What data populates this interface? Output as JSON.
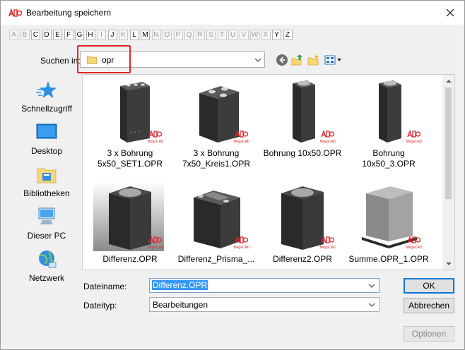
{
  "window": {
    "title": "Bearbeitung speichern"
  },
  "letters": [
    {
      "ch": "A",
      "on": false
    },
    {
      "ch": "B",
      "on": false
    },
    {
      "ch": "C",
      "on": true
    },
    {
      "ch": "D",
      "on": true
    },
    {
      "ch": "E",
      "on": true
    },
    {
      "ch": "F",
      "on": true
    },
    {
      "ch": "G",
      "on": true
    },
    {
      "ch": "H",
      "on": true
    },
    {
      "ch": "I",
      "on": false
    },
    {
      "ch": "J",
      "on": true
    },
    {
      "ch": "K",
      "on": false
    },
    {
      "ch": "L",
      "on": true
    },
    {
      "ch": "M",
      "on": true
    },
    {
      "ch": "N",
      "on": false
    },
    {
      "ch": "O",
      "on": false
    },
    {
      "ch": "P",
      "on": false
    },
    {
      "ch": "Q",
      "on": false
    },
    {
      "ch": "R",
      "on": false
    },
    {
      "ch": "S",
      "on": false
    },
    {
      "ch": "T",
      "on": false
    },
    {
      "ch": "U",
      "on": false
    },
    {
      "ch": "V",
      "on": false
    },
    {
      "ch": "W",
      "on": false
    },
    {
      "ch": "X",
      "on": false
    },
    {
      "ch": "Y",
      "on": true
    },
    {
      "ch": "Z",
      "on": true
    }
  ],
  "lookin": {
    "label": "Suchen in:",
    "value": "opr"
  },
  "places": [
    {
      "label": "Schnellzugriff",
      "icon": "star-icon"
    },
    {
      "label": "Desktop",
      "icon": "desktop-icon"
    },
    {
      "label": "Bibliotheken",
      "icon": "libraries-icon"
    },
    {
      "label": "Dieser PC",
      "icon": "computer-icon"
    },
    {
      "label": "Netzwerk",
      "icon": "network-icon"
    }
  ],
  "files": [
    {
      "line1": "3 x Bohrung",
      "line2": "5x50_SET1.OPR",
      "selected": false
    },
    {
      "line1": "3 x Bohrung",
      "line2": "7x50_Kreis1.OPR",
      "selected": false
    },
    {
      "line1": "Bohrung 10x50.OPR",
      "line2": "",
      "selected": false
    },
    {
      "line1": "Bohrung",
      "line2": "10x50_3.OPR",
      "selected": false
    },
    {
      "line1": "Differenz.OPR",
      "line2": "",
      "selected": true
    },
    {
      "line1": "Differenz_Prisma_...",
      "line2": "",
      "selected": false
    },
    {
      "line1": "Differenz2.OPR",
      "line2": "",
      "selected": false
    },
    {
      "line1": "Summe.OPR_1.OPR",
      "line2": "",
      "selected": false
    }
  ],
  "watermark": "MegaCAD",
  "filename": {
    "label": "Dateiname:",
    "value": "Differenz.OPR"
  },
  "filetype": {
    "label": "Dateityp:",
    "value": "Bearbeitungen"
  },
  "buttons": {
    "ok": "OK",
    "cancel": "Abbrechen",
    "options": "Optionen"
  },
  "colors": {
    "accent": "#0078d7",
    "highlight": "#e1252a",
    "selection": "#3399ff"
  }
}
